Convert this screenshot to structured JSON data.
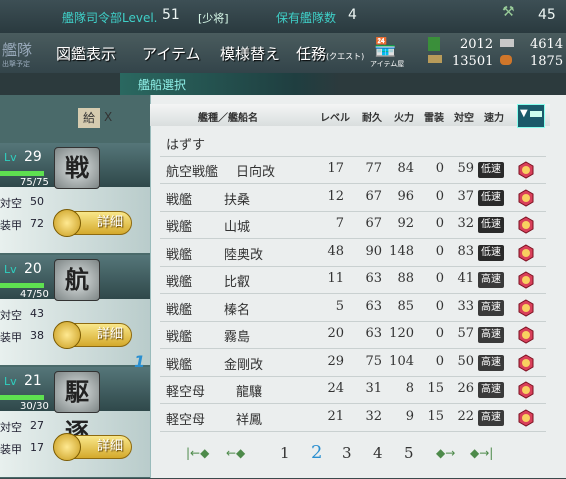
{
  "topbar": {
    "hq_label": "艦隊司令部Level.",
    "hq_level": "51",
    "rank": "[少将]",
    "ships_label": "保有艦隊数",
    "ships_count": "4",
    "right_value": "45"
  },
  "menu": {
    "fleet": "編成",
    "fleet_sub": "艦隊",
    "fleet_sub2": "出撃予定",
    "library": "図鑑表示",
    "items": "アイテム",
    "furniture": "模様替え",
    "quests": "任務",
    "quests_sub": "(クエスト)",
    "itemshop": "アイテム屋"
  },
  "resources": {
    "fuel": "2012",
    "ammo": "4614",
    "steel": "13501",
    "bauxite": "1875"
  },
  "subtitle": "艦船選択",
  "left_cards": [
    {
      "lv": "29",
      "hp": "75/75",
      "aa_label": "対空",
      "aa": "50",
      "armor_label": "装甲",
      "armor": "72",
      "badge": "戦",
      "detail": "詳細"
    },
    {
      "lv": "20",
      "hp": "47/50",
      "aa_label": "対空",
      "aa": "43",
      "armor_label": "装甲",
      "armor": "38",
      "badge": "航",
      "detail": "詳細"
    },
    {
      "lv": "21",
      "hp": "30/30",
      "aa_label": "対空",
      "aa": "27",
      "armor_label": "装甲",
      "armor": "17",
      "badge": "駆逐",
      "detail": "詳細"
    }
  ],
  "card_lv_label": "Lv",
  "supply_label": "給",
  "close_x": "X",
  "table": {
    "headers": {
      "ship": "艦種／艦船名",
      "level": "レベル",
      "hp": "耐久",
      "fire": "火力",
      "torp": "雷装",
      "aa": "対空",
      "speed": "速力"
    },
    "remove": "はずす",
    "rows": [
      {
        "type": "航空戦艦",
        "name": "日向改",
        "lv": "17",
        "hp": "77",
        "fire": "84",
        "torp": "0",
        "aa": "59",
        "speed": "低速"
      },
      {
        "type": "戦艦",
        "name": "扶桑",
        "lv": "12",
        "hp": "67",
        "fire": "96",
        "torp": "0",
        "aa": "37",
        "speed": "低速"
      },
      {
        "type": "戦艦",
        "name": "山城",
        "lv": "7",
        "hp": "67",
        "fire": "92",
        "torp": "0",
        "aa": "32",
        "speed": "低速"
      },
      {
        "type": "戦艦",
        "name": "陸奥改",
        "lv": "48",
        "hp": "90",
        "fire": "148",
        "torp": "0",
        "aa": "83",
        "speed": "低速"
      },
      {
        "type": "戦艦",
        "name": "比叡",
        "lv": "11",
        "hp": "63",
        "fire": "88",
        "torp": "0",
        "aa": "41",
        "speed": "高速"
      },
      {
        "type": "戦艦",
        "name": "榛名",
        "lv": "5",
        "hp": "63",
        "fire": "85",
        "torp": "0",
        "aa": "33",
        "speed": "高速"
      },
      {
        "type": "戦艦",
        "name": "霧島",
        "lv": "20",
        "hp": "63",
        "fire": "120",
        "torp": "0",
        "aa": "57",
        "speed": "高速"
      },
      {
        "type": "戦艦",
        "name": "金剛改",
        "lv": "29",
        "hp": "75",
        "fire": "104",
        "torp": "0",
        "aa": "50",
        "speed": "高速",
        "fleet_mark": "1"
      },
      {
        "type": "軽空母",
        "name": "龍驤",
        "lv": "24",
        "hp": "31",
        "fire": "8",
        "torp": "15",
        "aa": "26",
        "speed": "高速"
      },
      {
        "type": "軽空母",
        "name": "祥鳳",
        "lv": "21",
        "hp": "32",
        "fire": "9",
        "torp": "15",
        "aa": "22",
        "speed": "高速"
      }
    ]
  },
  "pagination": {
    "pages": [
      "1",
      "2",
      "3",
      "4",
      "5"
    ],
    "current": "2"
  },
  "colors": {
    "accent": "#3fd0c8",
    "panel": "#ebeeee",
    "speed_badge": "#333333",
    "lock": "#d9405a"
  }
}
